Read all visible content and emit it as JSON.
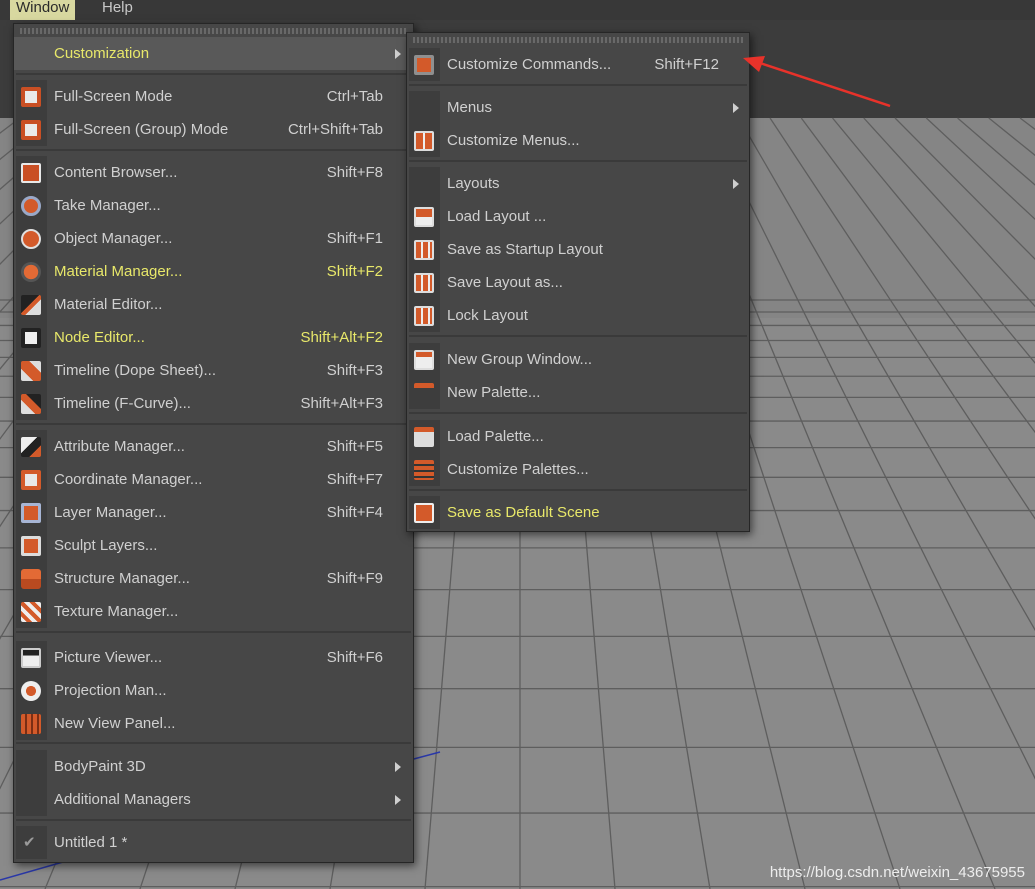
{
  "menubar": {
    "items": [
      {
        "label": "Window"
      },
      {
        "label": "Help"
      }
    ]
  },
  "window_menu": {
    "items": [
      {
        "label": "Customization"
      },
      {
        "label": "Full-Screen Mode",
        "shortcut": "Ctrl+Tab",
        "icon": "fullscreen-icon"
      },
      {
        "label": "Full-Screen (Group) Mode",
        "shortcut": "Ctrl+Shift+Tab",
        "icon": "fullscreen-group-icon"
      },
      {
        "label": "Content Browser...",
        "shortcut": "Shift+F8",
        "icon": "content-browser-icon"
      },
      {
        "label": "Take Manager...",
        "icon": "take-manager-icon"
      },
      {
        "label": "Object Manager...",
        "shortcut": "Shift+F1",
        "icon": "object-manager-icon"
      },
      {
        "label": "Material Manager...",
        "shortcut": "Shift+F2",
        "icon": "material-manager-icon"
      },
      {
        "label": "Material Editor...",
        "icon": "material-editor-icon"
      },
      {
        "label": "Node Editor...",
        "shortcut": "Shift+Alt+F2",
        "icon": "node-editor-icon"
      },
      {
        "label": "Timeline (Dope Sheet)...",
        "shortcut": "Shift+F3",
        "icon": "timeline-dope-sheet-icon"
      },
      {
        "label": "Timeline (F-Curve)...",
        "shortcut": "Shift+Alt+F3",
        "icon": "timeline-fcurve-icon"
      },
      {
        "label": "Attribute Manager...",
        "shortcut": "Shift+F5",
        "icon": "attribute-manager-icon"
      },
      {
        "label": "Coordinate Manager...",
        "shortcut": "Shift+F7",
        "icon": "coordinate-manager-icon"
      },
      {
        "label": "Layer Manager...",
        "shortcut": "Shift+F4",
        "icon": "layer-manager-icon"
      },
      {
        "label": "Sculpt Layers...",
        "icon": "sculpt-layers-icon"
      },
      {
        "label": "Structure Manager...",
        "shortcut": "Shift+F9",
        "icon": "structure-manager-icon"
      },
      {
        "label": "Texture Manager...",
        "icon": "texture-manager-icon"
      },
      {
        "label": "Picture Viewer...",
        "shortcut": "Shift+F6",
        "icon": "picture-viewer-icon"
      },
      {
        "label": "Projection Man...",
        "icon": "projection-man-icon"
      },
      {
        "label": "New View Panel...",
        "icon": "new-view-panel-icon"
      },
      {
        "label": "BodyPaint 3D"
      },
      {
        "label": "Additional Managers"
      },
      {
        "label": "Untitled 1 *",
        "icon": "check-icon"
      }
    ]
  },
  "customization_menu": {
    "items": [
      {
        "label": "Customize Commands...",
        "shortcut": "Shift+F12",
        "icon": "customize-commands-icon"
      },
      {
        "label": "Menus"
      },
      {
        "label": "Customize Menus...",
        "icon": "customize-menus-icon"
      },
      {
        "label": "Layouts"
      },
      {
        "label": "Load Layout ...",
        "icon": "load-layout-icon"
      },
      {
        "label": "Save as Startup Layout",
        "icon": "save-startup-layout-icon"
      },
      {
        "label": "Save Layout as...",
        "icon": "save-layout-icon"
      },
      {
        "label": "Lock Layout",
        "icon": "lock-layout-icon"
      },
      {
        "label": "New Group Window...",
        "icon": "new-group-window-icon"
      },
      {
        "label": "New Palette...",
        "icon": "new-palette-icon"
      },
      {
        "label": "Load Palette...",
        "icon": "load-palette-icon"
      },
      {
        "label": "Customize Palettes...",
        "icon": "customize-palettes-icon"
      },
      {
        "label": "Save as Default Scene",
        "icon": "save-default-scene-icon"
      }
    ]
  },
  "watermark": "https://blog.csdn.net/weixin_43675955",
  "colors": {
    "menu_bg": "#474747",
    "highlight_text": "#e8e86a",
    "annotation_arrow": "#e8322a",
    "icon_orange": "#d8582a"
  }
}
